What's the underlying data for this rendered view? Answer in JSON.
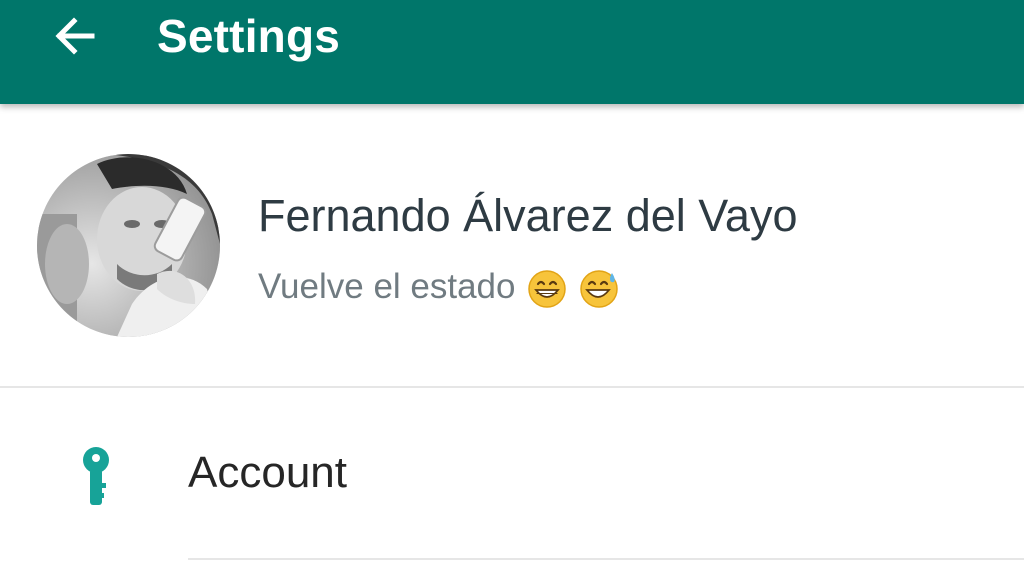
{
  "appbar": {
    "title": "Settings",
    "color": "#00766a"
  },
  "profile": {
    "name": "Fernando Álvarez del Vayo",
    "status_text": "Vuelve el estado",
    "status_emojis": [
      "grinning-face-icon",
      "grinning-face-with-sweat-icon"
    ]
  },
  "menu": {
    "items": [
      {
        "label": "Account",
        "icon": "key-icon",
        "icon_color": "#17a398"
      }
    ]
  }
}
